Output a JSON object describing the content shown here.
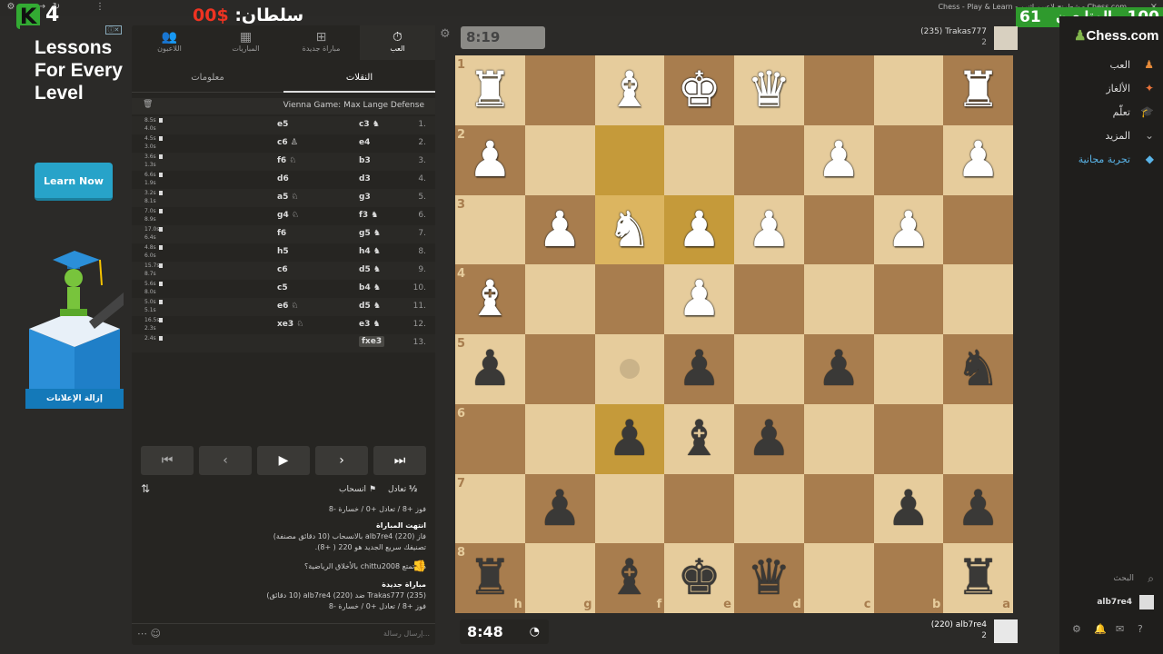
{
  "window": {
    "title": "Chess - Play & Learn - شطرنج لاعبين اثنين - Chess.com",
    "close": "×"
  },
  "overlay": {
    "k_letter": "K",
    "k_number": "4",
    "sultan_label": "سلطان:",
    "sultan_amount": "$00",
    "followers_count": "61",
    "followers_label": "المتابعين",
    "followers_goal": "100",
    "colors": {
      "green": "#2f9a2d",
      "red": "#e32222"
    }
  },
  "ad": {
    "badge": "ⓘ✕",
    "heading": "Lessons For Every Level",
    "button": "Learn Now",
    "remove": "إزالة الإعلانات"
  },
  "panel": {
    "tabs": [
      {
        "label": "العب",
        "icon": "stopwatch-icon"
      },
      {
        "label": "مباراة جديدة",
        "icon": "plus-icon"
      },
      {
        "label": "المباريات",
        "icon": "board-icon"
      },
      {
        "label": "اللاعبون",
        "icon": "players-icon"
      }
    ],
    "subtabs": {
      "moves": "النقلات",
      "info": "معلومات"
    },
    "opening": "Vienna Game: Max Lange Defense",
    "moves": [
      {
        "n": "1.",
        "w": "c3 ♞",
        "b": "e5",
        "tw": "",
        "tb": "8.5s",
        "tb2": "4.0s"
      },
      {
        "n": "2.",
        "w": "e4",
        "b": "c6 ♙",
        "tb": "4.5s",
        "tb2": "3.0s"
      },
      {
        "n": "3.",
        "w": "b3",
        "b": "f6 ♘",
        "tb": "3.6s",
        "tb2": "1.3s"
      },
      {
        "n": "4.",
        "w": "d3",
        "b": "d6",
        "tb": "6.6s",
        "tb2": "1.9s"
      },
      {
        "n": "5.",
        "w": "g3",
        "b": "a5 ♘",
        "tb": "3.2s",
        "tb2": "8.1s"
      },
      {
        "n": "6.",
        "w": "f3 ♞",
        "b": "g4 ♘",
        "tb": "7.0s",
        "tb2": "8.9s"
      },
      {
        "n": "7.",
        "w": "g5 ♞",
        "b": "f6",
        "tb": "17.0s",
        "tb2": "6.4s"
      },
      {
        "n": "8.",
        "w": "h4 ♞",
        "b": "h5",
        "tb": "4.8s",
        "tb2": "6.0s"
      },
      {
        "n": "9.",
        "w": "d5 ♞",
        "b": "c6",
        "tb": "15.7s",
        "tb2": "8.7s"
      },
      {
        "n": "10.",
        "w": "b4 ♞",
        "b": "c5",
        "tb": "5.6s",
        "tb2": "8.0s"
      },
      {
        "n": "11.",
        "w": "d5 ♞",
        "b": "e6 ♘",
        "tb": "5.0s",
        "tb2": "5.1s"
      },
      {
        "n": "12.",
        "w": "e3 ♞",
        "b": "xe3 ♘",
        "tb": "16.5s",
        "tb2": "2.3s"
      },
      {
        "n": "13.",
        "w": "fxe3",
        "b": "",
        "tb": "2.4s",
        "tb2": ""
      }
    ],
    "draw": "تعادل",
    "draw_icon": "½",
    "resign": "انسحاب",
    "log": {
      "l1": "فوز +8 / تعادل +0 / خسارة -8",
      "l2": "انتهت المباراة",
      "l3": "فاز (220) alb7re4 بالانسحاب (10 دقائق مصنفة)",
      "l4": "تصنيفك سريع الجديد هو 220 ( +8).",
      "l5": "هل تمتع chittu2008 بالأخلاق الرياضية؟",
      "l6": "مباراة جديدة",
      "l7": "(235) Trakas777 ضد (220) alb7re4 (10 دقائق)",
      "l8": "فوز +8 / تعادل +0 / خسارة -8"
    },
    "chat_placeholder": "إرسال رسالة..."
  },
  "board": {
    "clock_top": "8:19",
    "clock_bottom": "8:48",
    "player_top": {
      "name": "(235) Trakas777",
      "sub": "2"
    },
    "player_bottom": {
      "name": "(220) alb7re4",
      "sub": "2"
    },
    "ranks": [
      "1",
      "2",
      "3",
      "4",
      "5",
      "6",
      "7",
      "8"
    ],
    "files": [
      "h",
      "g",
      "f",
      "e",
      "d",
      "c",
      "b",
      "a"
    ],
    "position": [
      [
        "wR",
        "",
        "wB",
        "wK",
        "wQ",
        "",
        "",
        "wR"
      ],
      [
        "wP",
        "",
        "",
        "",
        "",
        "wP",
        "",
        "wP"
      ],
      [
        "",
        "wP",
        "wN",
        "wP",
        "wP",
        "",
        "wP",
        ""
      ],
      [
        "wB",
        "",
        "",
        "wP",
        "",
        "",
        "",
        ""
      ],
      [
        "bP",
        "",
        "",
        "bP",
        "",
        "bP",
        "",
        "bN"
      ],
      [
        "",
        "",
        "bP",
        "bB",
        "bP",
        "",
        "",
        ""
      ],
      [
        "",
        "bP",
        "",
        "",
        "",
        "",
        "bP",
        "bP"
      ],
      [
        "bR",
        "",
        "bB",
        "bK",
        "bQ",
        "",
        "",
        "bR"
      ]
    ],
    "highlights": [
      [
        1,
        2
      ],
      [
        2,
        2
      ],
      [
        2,
        3
      ],
      [
        5,
        2
      ]
    ],
    "colors": {
      "light": "#e6cc9c",
      "dark": "#a87d4e"
    }
  },
  "nav": {
    "logo": "Chess.com",
    "items": [
      {
        "label": "العب",
        "icon": "play-icon"
      },
      {
        "label": "الألغاز",
        "icon": "puzzle-icon"
      },
      {
        "label": "تعلّم",
        "icon": "learn-icon"
      },
      {
        "label": "المزيد",
        "icon": "more-icon"
      },
      {
        "label": "تجربة مجانية",
        "icon": "diamond-icon"
      }
    ],
    "search": "البحث",
    "user": "alb7re4"
  }
}
